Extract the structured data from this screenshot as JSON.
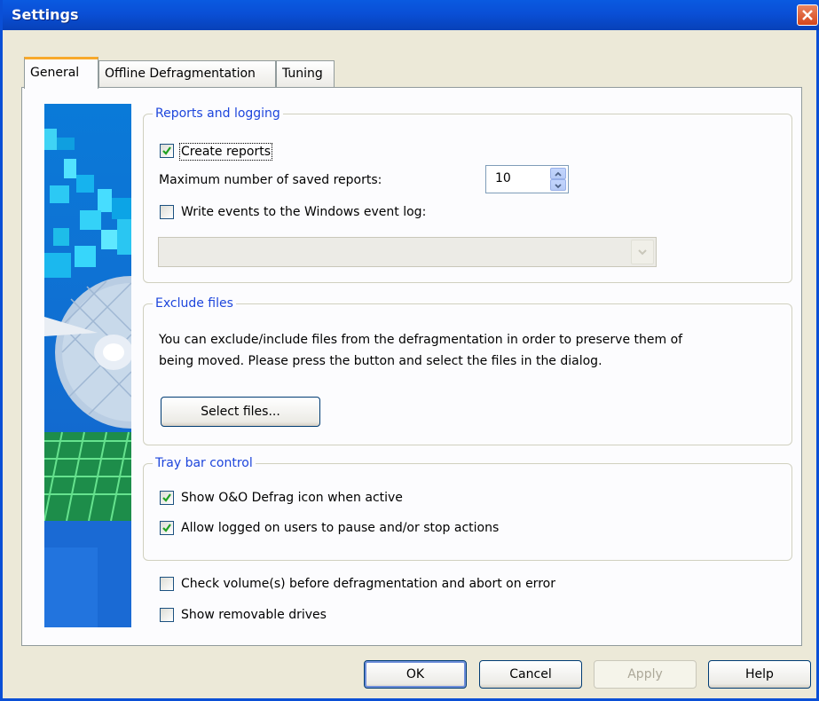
{
  "window": {
    "title": "Settings"
  },
  "tabs": [
    {
      "label": "General"
    },
    {
      "label": "Offline Defragmentation"
    },
    {
      "label": "Tuning"
    }
  ],
  "reports": {
    "group_title": "Reports and logging",
    "create_reports_label": "Create reports",
    "create_reports_checked": true,
    "max_reports_label": "Maximum number of saved reports:",
    "max_reports_value": "10",
    "write_events_label": "Write events to the Windows event log:",
    "write_events_checked": false,
    "event_log_selected": ""
  },
  "exclude": {
    "group_title": "Exclude files",
    "description_line1": "You can exclude/include files from the defragmentation in order to preserve them of",
    "description_line2": "being moved. Please press the button and select the files in the dialog.",
    "select_button": "Select files..."
  },
  "tray": {
    "group_title": "Tray bar control",
    "show_icon_label": "Show O&O Defrag icon when active",
    "show_icon_checked": true,
    "allow_users_label": "Allow logged on users to pause and/or stop actions",
    "allow_users_checked": true
  },
  "options": {
    "check_volume_label": "Check volume(s) before defragmentation and abort on error",
    "check_volume_checked": false,
    "removable_label": "Show removable drives",
    "removable_checked": false
  },
  "buttons": {
    "ok": "OK",
    "cancel": "Cancel",
    "apply": "Apply",
    "help": "Help"
  },
  "colors": {
    "titlebar": "#0a4fd6",
    "group_title": "#1e46dc",
    "dialog_bg": "#ece9d8",
    "panel_bg": "#fcfcfe"
  }
}
